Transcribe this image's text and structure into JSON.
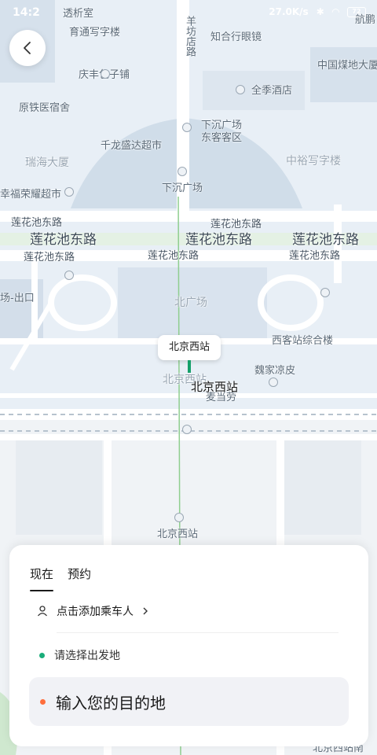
{
  "status_bar": {
    "time": "14:2",
    "network_speed": "27.0K/s",
    "battery": "72"
  },
  "map": {
    "labels": {
      "tousi": "透析室",
      "yutong": "育通写字楼",
      "yangfang": "羊坊店路",
      "zhihe": "知合行眼镜",
      "hang": "航鹏",
      "qingfeng": "庆丰包子铺",
      "meimei_coal": "中国煤地大厦",
      "quanji": "全季酒店",
      "yuanliang": "原铁医宿舍",
      "xiachen": "下沉广场",
      "dongke": "东客客区",
      "qianlong": "千龙盛达超市",
      "ruihai": "瑞海大厦",
      "zhongyu": "中裕写字楼",
      "xiachen2": "下沉广场",
      "xingfu": "幸福荣耀超市",
      "lianhua_e1": "莲花池东路",
      "lianhua_e2": "莲花池东路",
      "lianhua_big1": "莲花池东路",
      "lianhua_big2": "莲花池东路",
      "lianhua_big3": "莲花池东路",
      "lianhua_e3": "莲花池东路",
      "lianhua_e4": "莲花池东路",
      "lianhua_e5": "莲花池东路",
      "chukou": "场-出口",
      "beiguangchang": "北广场",
      "xikezhan": "西客站综合楼",
      "weijia": "魏家凉皮",
      "beijingxizhan_muted": "北京西站",
      "maidanglao": "麦当劳",
      "beijingxizhan_bottom": "北京西站",
      "beijingxi_south": "北京西站南"
    },
    "station": {
      "tag": "北京西站",
      "label": "北京西站"
    }
  },
  "back_button": {
    "icon": "chevron-left-icon"
  },
  "panel": {
    "tabs": [
      {
        "label": "现在",
        "active": true
      },
      {
        "label": "预约",
        "active": false
      }
    ],
    "add_passenger": "点击添加乘车人",
    "origin_placeholder": "请选择出发地",
    "destination_placeholder": "输入您的目的地",
    "colors": {
      "origin": "#1aad7a",
      "destination": "#ff6e3c"
    }
  }
}
